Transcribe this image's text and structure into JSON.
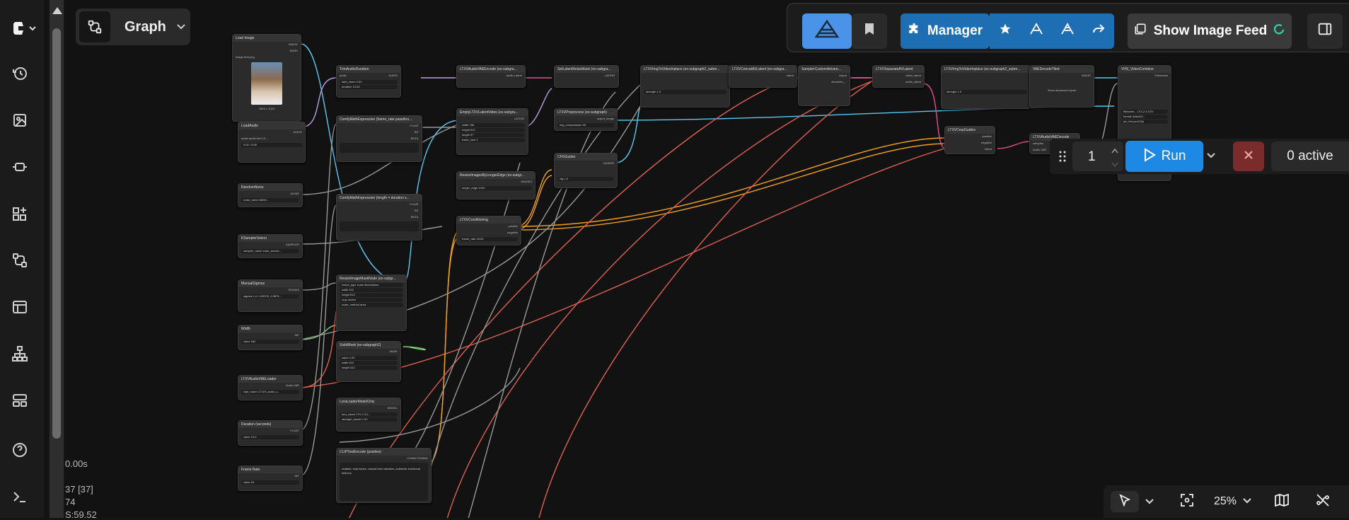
{
  "graph_menu": {
    "label": "Graph"
  },
  "top_bar": {
    "manager_label": "Manager",
    "show_image_feed_label": "Show Image Feed"
  },
  "run_panel": {
    "batch_count": "1",
    "run_label": "Run",
    "active_label": "0 active"
  },
  "zoom": {
    "level": "25%"
  },
  "stats": {
    "line1": "0.00s",
    "line2": "37 [37]",
    "line3": "74",
    "line4": "S:59.52"
  },
  "nodes": {
    "load_image": {
      "title": "Load Image",
      "out1": "IMAGE",
      "out2": "MASK",
      "image_label": "image",
      "image_value": "Anh.png",
      "caption": "1024 × 1024"
    },
    "load_audio": {
      "title": "LoadAudio",
      "out": "AUDIO",
      "audio_label": "audio",
      "audio_value": "audio-test 10 ...",
      "time": "0:00 / 0:08"
    },
    "random_noise": {
      "title": "RandomNoise",
      "out": "NOISE",
      "label": "noise_seed",
      "value": "16000..."
    },
    "ksampler_select": {
      "title": "KSamplerSelect",
      "out": "SAMPLER",
      "label": "sampler_name",
      "value": "euler_ancest..."
    },
    "manual_sigmas": {
      "title": "ManualSigmas",
      "out": "SIGMAS",
      "label": "sigmas",
      "value": "1.0, 0.99375, 0.9875..."
    },
    "width": {
      "title": "Width",
      "out": "INT",
      "label": "value",
      "value": "540"
    },
    "audio_vae_loader": {
      "title": "LTXVAudioVAELoader",
      "out": "Audio VAE",
      "label": "ckpt_name",
      "value": "LTX23_audio_v..."
    },
    "duration": {
      "title": "Duration (seconds)",
      "out": "FLOAT",
      "label": "value",
      "value": "10.0"
    },
    "frame_rate": {
      "title": "Frame Rate",
      "out": "INT",
      "label": "value",
      "value": "24"
    },
    "trim_audio": {
      "title": "TrimAudioDuration",
      "in": "audio",
      "out": "AUDIO",
      "r1": "start_index",
      "v1": "0.00",
      "r2": "duration",
      "v2": "10.00"
    },
    "math1": {
      "title": "ComfyMathExpression (frame_rate passthro...",
      "o1": "FLOAT",
      "o2": "INT",
      "o3": "BOOL"
    },
    "math2": {
      "title": "ComfyMathExpression (length = duration x...",
      "o1": "FLOAT",
      "o2": "INT",
      "o3": "BOOL"
    },
    "resize_image": {
      "title": "ResizeImageMaskNode (ex-subgr...",
      "r1": "resize_type",
      "v1": "scale dimensions",
      "r2": "width",
      "v2": "512",
      "r3": "height",
      "v3": "512",
      "r4": "crop",
      "v4": "center",
      "r5": "scale_method",
      "v5": "area"
    },
    "solid_mask": {
      "title": "SolidMask (ex-subgraph2)",
      "out": "MASK",
      "r1": "value",
      "v1": "1.00",
      "r2": "width",
      "v2": "512",
      "r3": "height",
      "v3": "512"
    },
    "lora_loader": {
      "title": "LoraLoaderModelOnly",
      "out": "MODEL",
      "r1": "lora_name",
      "v1": "LTX-2.3-2...",
      "r2": "strength_model",
      "v2": "1.00"
    },
    "clip_encode": {
      "title": "CLIPTextEncode (positive)",
      "out": "CONDITIONING",
      "text": "realistic, expressive, natural lose variation, authentic emotional delivery"
    },
    "audio_vae_encode": {
      "title": "LTXVAudioVAEEncode (ex-subgra...",
      "out": "Audio Latent"
    },
    "empty_latent": {
      "title": "EmptyLTXVLatentVideo (ex-subgra...",
      "out": "LATENT",
      "r1": "width",
      "v1": "768",
      "r2": "height",
      "v2": "512",
      "r3": "length",
      "v3": "97",
      "r4": "batch_size",
      "v4": "1"
    },
    "resize_longer": {
      "title": "ResizeImagesByLongerEdge (ex-subgr...",
      "out": "IMAGES",
      "r1": "longer_edge",
      "v1": "1024"
    },
    "cond_batching": {
      "title": "LTXVConditioning",
      "o1": "positive",
      "o2": "negative",
      "r1": "frame_rate",
      "v1": "25.00"
    },
    "set_latent_mask": {
      "title": "SetLatentNoiseMask (ex-subgra...",
      "out": "LATENT"
    },
    "ltxv_preprocess": {
      "title": "LTXVPreprocess (ex-subgraph)",
      "out": "output_image",
      "r1": "img_compression",
      "v1": "35"
    },
    "cfg_guider": {
      "title": "CFGGuider",
      "out": "GUIDER",
      "r1": "cfg",
      "v1": "1.0"
    },
    "img_to_video": {
      "title": "LTXVImgToVideoInplace (ex-subgraph2_subm...",
      "r1": "strength",
      "v1": "1.0"
    },
    "concat_av": {
      "title": "LTXVConcatAVLatent (ex-subgra...",
      "out": "latent"
    },
    "sampler_custom": {
      "title": "SamplerCustomAdvanc...",
      "o1": "output",
      "o2": "denoised_..."
    },
    "separate_av": {
      "title": "LTXVSeparateAVLatent",
      "o1": "video_latent",
      "o2": "audio_latent"
    },
    "img_to_video2": {
      "title": "LTXVImgToVideoInplace (ex-subgraph2_subm...",
      "r1": "strength",
      "v1": "1.0"
    },
    "vae_decode": {
      "title": "VAEDecodeTiled",
      "out": "IMAGE",
      "btn": "Show advanced inputs"
    },
    "crop_guides": {
      "title": "LTXVCropGuides",
      "o1": "positive",
      "o2": "negative",
      "o3": "latent"
    },
    "video_combine": {
      "title": "VHS_VideoCombine",
      "out": "Filenames",
      "r1": "filename...",
      "v1": "LTX-2.3-V2V",
      "r2": "format",
      "v2": "video/h2...",
      "r3": "pix_fmt",
      "v3": "yuv420p"
    },
    "audio_decode": {
      "title": "LTXVAudioVAEDecode",
      "o1": "samples",
      "o2": "Audio VAE"
    }
  },
  "colors": {
    "accent_blue": "#1e88e5",
    "manager_blue": "#1e6eb3",
    "cancel_red": "#7a2b2b",
    "wire_orange": "#f0a020",
    "wire_pink": "#e0508a",
    "wire_cyan": "#5ac8f0",
    "wire_red": "#e06050",
    "wire_green": "#7ccf7a",
    "wire_lavender": "#b9a0e8"
  },
  "icons": [
    "comfy-logo-icon",
    "history-icon",
    "image-gallery-icon",
    "model-library-icon",
    "templates-icon",
    "workflows-icon",
    "queue-icon",
    "node-library-icon",
    "layout-icon",
    "help-icon",
    "terminal-icon",
    "graph-icon",
    "bookmark-icon",
    "puzzle-icon",
    "star-icon",
    "share-icon",
    "image-feed-icon",
    "panel-toggle-icon",
    "play-icon",
    "close-icon",
    "pointer-icon",
    "fit-view-icon",
    "minimap-icon",
    "link-visibility-icon"
  ]
}
